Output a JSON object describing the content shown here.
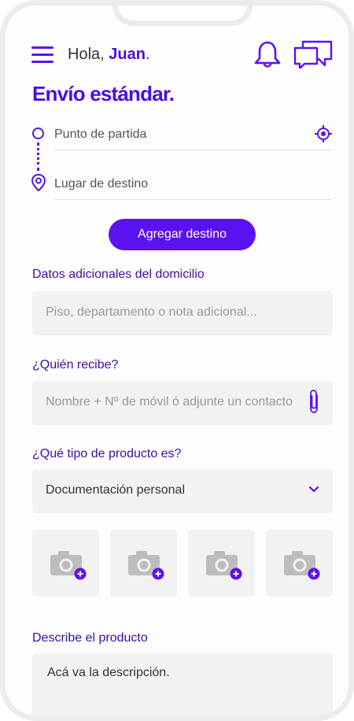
{
  "header": {
    "greeting_prefix": "Hola,",
    "user_name": "Juan",
    "greeting_suffix": "."
  },
  "title": "Envío estándar.",
  "route": {
    "start_placeholder": "Punto de partida",
    "end_placeholder": "Lugar de destino"
  },
  "add_destination_label": "Agregar destino",
  "address_details": {
    "label": "Datos adicionales del domicilio",
    "placeholder": "Piso, departamento o nota adicional..."
  },
  "recipient": {
    "label": "¿Quién recibe?",
    "placeholder": "Nombre + Nº de móvil ó adjunte un contacto"
  },
  "product_type": {
    "label": "¿Qué tipo de producto es?",
    "selected": "Documentación personal"
  },
  "photos": [
    {
      "icon": "camera-add-icon"
    },
    {
      "icon": "camera-add-icon"
    },
    {
      "icon": "camera-add-icon"
    },
    {
      "icon": "camera-add-icon"
    }
  ],
  "description": {
    "label": "Describe el producto",
    "value": "Acá va la descripción."
  },
  "colors": {
    "accent": "#5b12f0",
    "label": "#3a0fa0",
    "field_bg": "#f2f2f2"
  }
}
